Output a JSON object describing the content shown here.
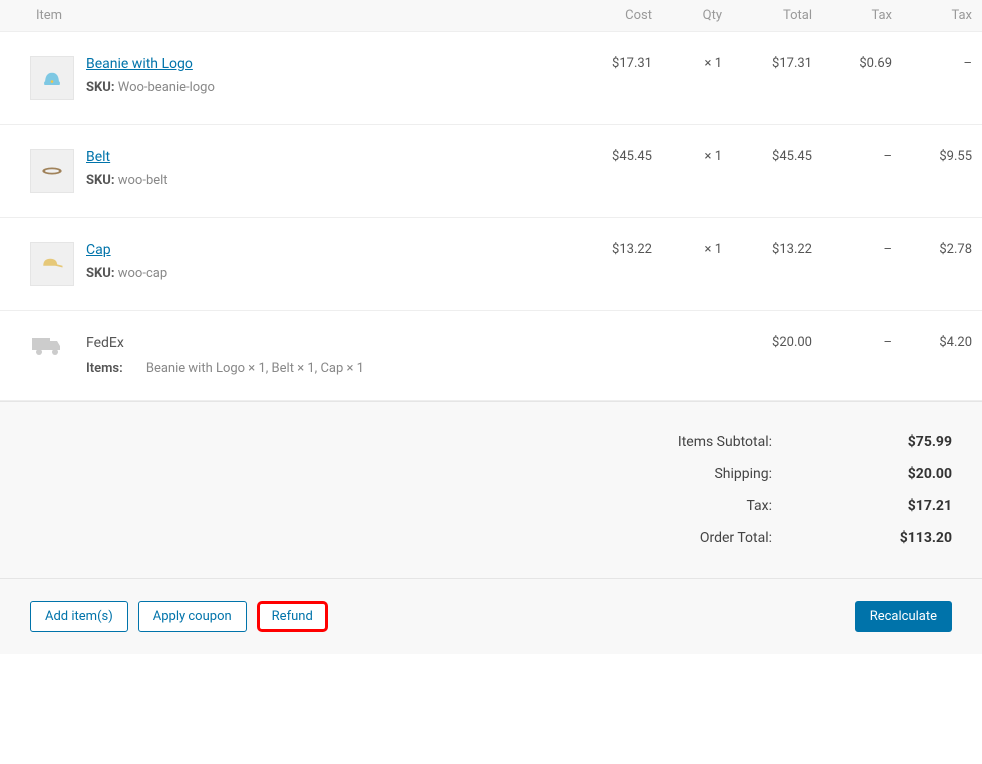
{
  "headers": {
    "item": "Item",
    "cost": "Cost",
    "qty": "Qty",
    "total": "Total",
    "tax1": "Tax",
    "tax2": "Tax"
  },
  "sku_label": "SKU:",
  "qty_prefix": "×",
  "empty_dash": "–",
  "items": [
    {
      "name": "Beanie with Logo",
      "sku": "Woo-beanie-logo",
      "cost": "$17.31",
      "qty": "1",
      "total": "$17.31",
      "tax1": "$0.69",
      "tax2": "–"
    },
    {
      "name": "Belt",
      "sku": "woo-belt",
      "cost": "$45.45",
      "qty": "1",
      "total": "$45.45",
      "tax1": "–",
      "tax2": "$9.55"
    },
    {
      "name": "Cap",
      "sku": "woo-cap",
      "cost": "$13.22",
      "qty": "1",
      "total": "$13.22",
      "tax1": "–",
      "tax2": "$2.78"
    }
  ],
  "shipping": {
    "name": "FedEx",
    "items_label": "Items:",
    "items_value": "Beanie with Logo × 1, Belt × 1, Cap × 1",
    "total": "$20.00",
    "tax1": "–",
    "tax2": "$4.20"
  },
  "totals": {
    "subtotal_label": "Items Subtotal:",
    "subtotal_value": "$75.99",
    "shipping_label": "Shipping:",
    "shipping_value": "$20.00",
    "tax_label": "Tax:",
    "tax_value": "$17.21",
    "order_total_label": "Order Total:",
    "order_total_value": "$113.20"
  },
  "actions": {
    "add_items": "Add item(s)",
    "apply_coupon": "Apply coupon",
    "refund": "Refund",
    "recalculate": "Recalculate"
  }
}
